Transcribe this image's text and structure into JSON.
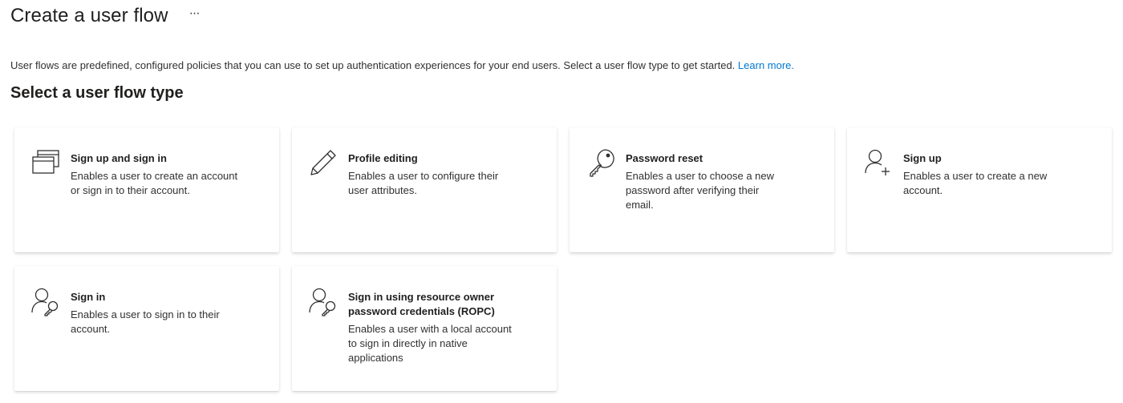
{
  "header": {
    "title": "Create a user flow",
    "more_label": "···"
  },
  "description": {
    "text": "User flows are predefined, configured policies that you can use to set up authentication experiences for your end users. Select a user flow type to get started.",
    "link_label": "Learn more."
  },
  "section": {
    "title": "Select a user flow type"
  },
  "cards": [
    {
      "title": "Sign up and sign in",
      "desc_lines": [
        "Enables a user to create an account",
        "or sign in to their account."
      ],
      "icon": "windows-icon"
    },
    {
      "title": "Profile editing",
      "desc_lines": [
        "Enables a user to configure their",
        "user attributes."
      ],
      "icon": "pencil-icon"
    },
    {
      "title": "Password reset",
      "desc_lines": [
        "Enables a user to choose a new",
        "password after verifying their",
        "email."
      ],
      "icon": "key-icon"
    },
    {
      "title": "Sign up",
      "desc_lines": [
        "Enables a user to create a new",
        "account."
      ],
      "icon": "person-add-icon"
    },
    {
      "title": "Sign in",
      "desc_lines": [
        "Enables a user to sign in to their",
        "account."
      ],
      "icon": "person-key-icon"
    },
    {
      "title_lines": [
        "Sign in using resource owner",
        "password credentials (ROPC)"
      ],
      "desc_lines": [
        "Enables a user with a local account",
        "to sign in directly in native",
        "applications"
      ],
      "icon": "person-key-icon"
    }
  ],
  "colors": {
    "link": "#0078d4",
    "text": "#323130",
    "title": "#201f1e",
    "icon_stroke": "#323130"
  }
}
